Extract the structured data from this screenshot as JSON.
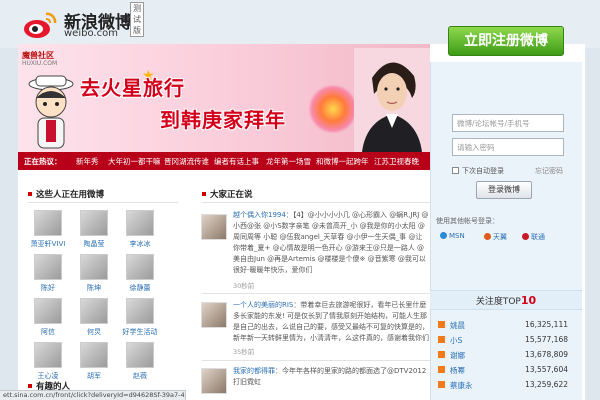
{
  "header": {
    "logo_cn": "新浪微博",
    "logo_en": "weibo.com",
    "beta_label": "测试版"
  },
  "banner": {
    "site_name": "魔兽社区",
    "site_url": "HUXIU.COM",
    "headline_line1": "去火星旅行",
    "headline_line2": "到韩庚家拜年"
  },
  "nav": {
    "items": [
      "正在热议：",
      "新年秀",
      "大年初一都干嘛",
      "晋冈湖流传谁",
      "编者有话上事",
      "龙年第一场雪",
      "和微博一起跨年",
      "江苏卫视春晚"
    ]
  },
  "sections": {
    "using_title": "这些人正在用微博",
    "saying_title": "大家正在说",
    "interesting_title": "有趣的人"
  },
  "users": [
    {
      "name": "萧亚轩VIVI"
    },
    {
      "name": "陶晶莹"
    },
    {
      "name": "李冰冰"
    },
    {
      "name": "陈好"
    },
    {
      "name": "陈坤"
    },
    {
      "name": "徐静蕾"
    },
    {
      "name": "阿信"
    },
    {
      "name": "何炅"
    },
    {
      "name": "好学生活动"
    },
    {
      "name": "王心凌"
    },
    {
      "name": "胡军"
    },
    {
      "name": "赵薇"
    }
  ],
  "feed": [
    {
      "user": "越个偶入你1994",
      "text": "：【4】@小小小小几 @心形霸入 @蜗R,JRJ @小西@张 @小S数字亲笔 @未曾高开_小 @我是你的小太阳 @周同周等 小聪 @伍我angel_天草春 @小伊一生天偶_事 @让你带着_夏+ @心情故是明一色开心 @游来王@只是一路人 @美自由Jun @再是Artemis @楼楼是个傻※ @音紫寒 @我可以很好-暖暖年快乐，爱你们",
      "time": "30秒前"
    },
    {
      "user": "一个人的美丽的RIS",
      "text": "：带着幸巨去旅游呢很好，看年已长里什麼多长家能的东发! 可是仅长到了情我原刻开始结构，可能人生那是自己的出去，么说自己的要，感受又最结不可复的快算是的，新年新一天转鲜里情为，小清清年，么这件真的，感谢着我你们也看到了。",
      "time": "35秒前"
    },
    {
      "user": "我家的都得罪",
      "text": "：今年年各样的里家的路的都面选了@DTV2012打旧霓虹",
      "time": ""
    }
  ],
  "login": {
    "register_label": "立即注册微博",
    "account_placeholder": "微博/论坛帐号/手机号",
    "password_placeholder": "请输入密码",
    "remember_label": "下次自动登录",
    "forgot_label": "忘记密码",
    "login_label": "登录微博"
  },
  "external_login": {
    "title": "使用其他帐号登录：",
    "providers": [
      "MSN",
      "天翼",
      "联通"
    ]
  },
  "top10": {
    "title_prefix": "关注度TOP",
    "title_number": "10",
    "ranks": [
      {
        "name": "姚晨",
        "count": "16,325,111"
      },
      {
        "name": "小S",
        "count": "15,577,168"
      },
      {
        "name": "谢娜",
        "count": "13,678,809"
      },
      {
        "name": "杨幂",
        "count": "13,557,604"
      },
      {
        "name": "蔡康永",
        "count": "13,259,622"
      }
    ]
  },
  "statusbar": {
    "text": "ett.sina.com.cn/front/click?deliveryId=d94628Sf-39a7-4da7-9d71-d0c..."
  },
  "colors": {
    "brand_red": "#d4001b",
    "nav_red": "#b80018",
    "register_green": "#3d9b16",
    "link_blue": "#2a6fb5"
  }
}
